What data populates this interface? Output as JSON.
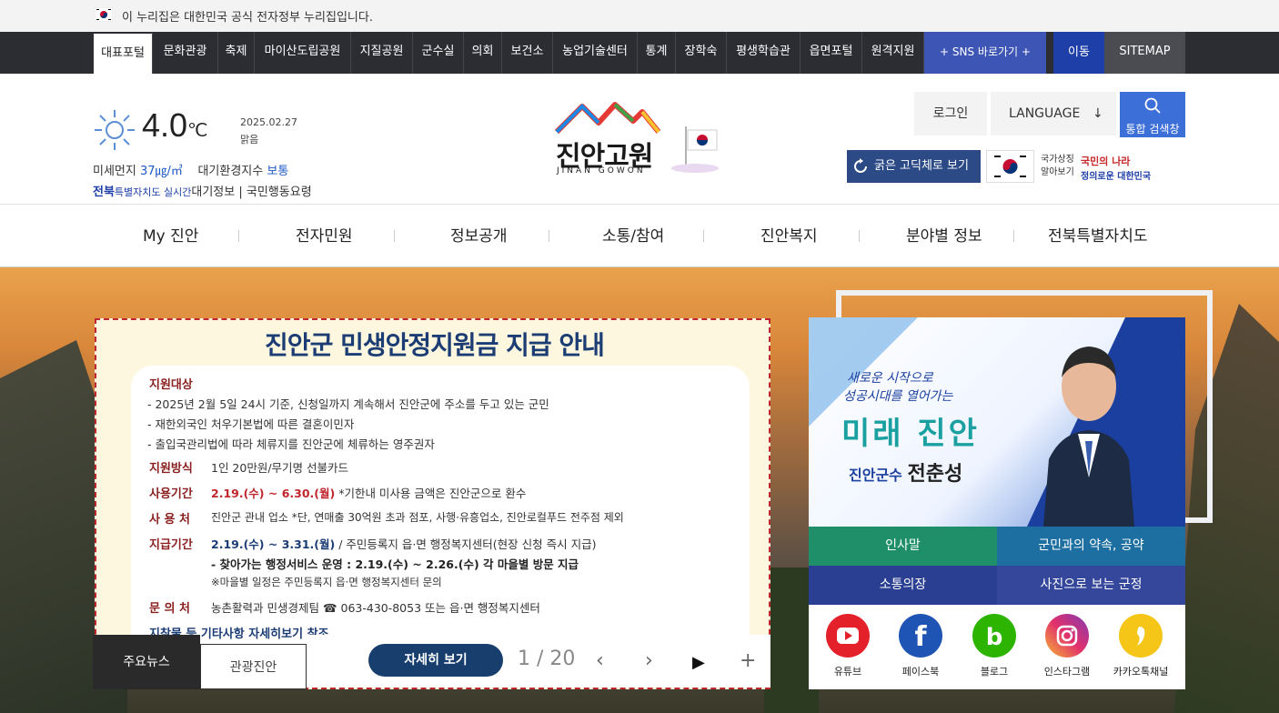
{
  "gov_banner": {
    "text": "이 누리집은 대한민국 공식 전자정부 누리집입니다."
  },
  "topnav": {
    "items": [
      "대표포털",
      "문화관광",
      "축제",
      "마이산도립공원",
      "지질공원",
      "군수실",
      "의회",
      "보건소",
      "농업기술센터",
      "통계",
      "장학숙",
      "평생학습관",
      "읍면포털",
      "원격지원"
    ],
    "sns": "+ SNS 바로가기 +",
    "move": "이동",
    "sitemap": "SITEMAP"
  },
  "weather": {
    "temp": "4.0",
    "unit": "℃",
    "date": "2025.02.27",
    "state": "맑음",
    "dust_label": "미세먼지",
    "dust_value": "37㎍/㎥",
    "aqi_label": "대기환경지수",
    "aqi_value": "보통",
    "jeonbuk_1": "전북",
    "jeonbuk_2": "특별자치도 실시간",
    "jeonbuk_3": "대기정보",
    "civil": "국민행동요령"
  },
  "logo": {
    "title": "진안고원",
    "sub": "JINAN GOWON"
  },
  "header": {
    "login": "로그인",
    "language": "LANGUAGE",
    "search": "통합 검색창",
    "font_btn": "굵은 고딕체로 보기",
    "nat_symbol_1": "국가상징",
    "nat_symbol_2": "알아보기",
    "nat_logo_1": "국민의 나라",
    "nat_logo_2": "정의로운 대한민국"
  },
  "mainnav": [
    "My 진안",
    "전자민원",
    "정보공개",
    "소통/참여",
    "진안복지",
    "분야별 정보",
    "전북특별자치도"
  ],
  "popup": {
    "title": "진안군 민생안정지원금 지급 안내",
    "s1": "지원대상",
    "l1": "- 2025년 2월 5일 24시 기준, 신청일까지 계속해서 진안군에 주소를 두고 있는 군민",
    "l2": "- 재한외국인 처우기본법에 따른 결혼이민자",
    "l3": "- 출입국관리법에 따라 체류지를 진안군에 체류하는 영주권자",
    "s2": "지원방식",
    "l4": "1인 20만원/무기명 선불카드",
    "s3": "사용기간",
    "l5a": "2.19.(수) ~ 6.30.(월)",
    "l5b": " *기한내 미사용 금액은 진안군으로 환수",
    "s4": "사 용 처",
    "l6": "진안군 관내 업소 *단, 연매출 30억원 초과 점포, 사행·유흥업소, 진안로컬푸드 전주점 제외",
    "s5": "지급기간",
    "l7a": "2.19.(수) ~ 3.31.(월)",
    "l7b": " / 주민등록지 읍·면 행정복지센터(현장 신청 즉시 지급)",
    "l8": "- 찾아가는 행정서비스 운영 : 2.19.(수) ~ 2.26.(수) 각 마을별 방문 지급",
    "l9": "※마을별 일정은 주민등록지 읍·면 행정복지센터 문의",
    "s6": "문 의 처",
    "l10": "농촌활력과 민생경제팀 ☎ 063-430-8053 또는 읍·면 행정복지센터",
    "s7": "지참물 등 기타사항 자세히보기 참조"
  },
  "slider": {
    "news_tab": "주요뉴스",
    "tour_tab": "관광진안",
    "detail": "자세히 보기",
    "pager": "1 / 20"
  },
  "mayor": {
    "slogan_1": "새로운 시작으로",
    "slogan_2": "성공시대를 열어가는",
    "slogan_3": "미래 진안",
    "role": "진안군수",
    "name": "전춘성",
    "btn_greeting": "인사말",
    "btn_pledge": "군민과의 약속, 공약",
    "btn_comm": "소통의장",
    "btn_photo": "사진으로 보는 군정"
  },
  "sns": [
    {
      "label": "유튜브",
      "color": "#e4202a",
      "icon": "youtube-icon"
    },
    {
      "label": "페이스북",
      "color": "#1e55b5",
      "icon": "facebook-icon"
    },
    {
      "label": "블로그",
      "color": "#2db400",
      "icon": "blog-icon"
    },
    {
      "label": "인스타그램",
      "color": "#d6337f",
      "icon": "instagram-icon"
    },
    {
      "label": "카카오톡채널",
      "color": "#f5c518",
      "icon": "kakao-icon"
    }
  ]
}
